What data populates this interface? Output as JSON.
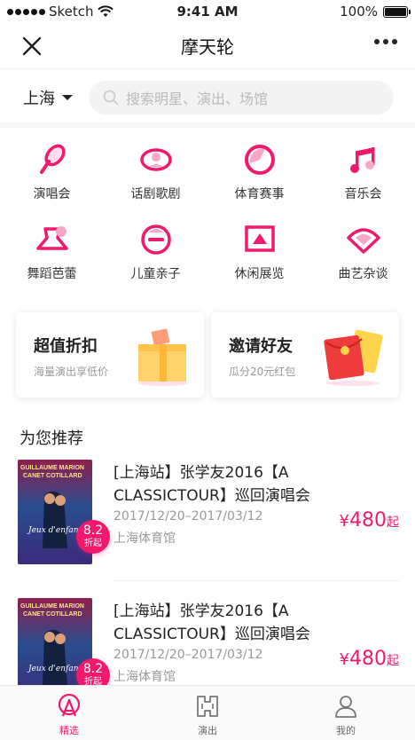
{
  "status": {
    "carrier": "Sketch",
    "time": "9:41 AM",
    "battery": "100%"
  },
  "nav": {
    "title": "摩天轮"
  },
  "search": {
    "city": "上海",
    "placeholder": "搜索明星、演出、场馆"
  },
  "categories": [
    {
      "label": "演唱会",
      "icon": "microphone-icon"
    },
    {
      "label": "话剧歌剧",
      "icon": "drama-mask-icon"
    },
    {
      "label": "体育赛事",
      "icon": "ball-icon"
    },
    {
      "label": "音乐会",
      "icon": "music-note-icon"
    },
    {
      "label": "舞蹈芭蕾",
      "icon": "ballet-skirt-icon"
    },
    {
      "label": "儿童亲子",
      "icon": "child-face-icon"
    },
    {
      "label": "休闲展览",
      "icon": "exhibition-frame-icon"
    },
    {
      "label": "曲艺杂谈",
      "icon": "folding-fan-icon"
    }
  ],
  "promos": [
    {
      "title": "超值折扣",
      "subtitle": "海量演出享低价",
      "icon": "gift-box-icon"
    },
    {
      "title": "邀请好友",
      "subtitle": "瓜分20元红包",
      "icon": "red-envelope-icon"
    }
  ],
  "section_title": "为您推荐",
  "items": [
    {
      "title": "[上海站】张学友2016【A CLASSICTOUR】巡回演唱会",
      "date": "2017/12/20–2017/03/12",
      "venue": "上海体育馆",
      "currency": "¥",
      "price": "480",
      "price_suffix": "起",
      "discount": "8.2",
      "discount_label": "折起"
    },
    {
      "title": "[上海站】张学友2016【A CLASSICTOUR】巡回演唱会",
      "date": "2017/12/20–2017/03/12",
      "venue": "上海体育馆",
      "currency": "¥",
      "price": "480",
      "price_suffix": "起",
      "discount": "8.2",
      "discount_label": "折起"
    }
  ],
  "poster_text": {
    "line1": "GUILLAUME  MARION",
    "line2": "CANET  COTILLARD",
    "script": "Jeux d'enfants"
  },
  "tabs": [
    {
      "label": "精选",
      "icon": "featured-icon",
      "active": true
    },
    {
      "label": "演出",
      "icon": "ticket-icon",
      "active": false
    },
    {
      "label": "我的",
      "icon": "user-icon",
      "active": false
    }
  ],
  "colors": {
    "accent": "#f0196b",
    "text": "#222222",
    "muted": "#999999"
  }
}
